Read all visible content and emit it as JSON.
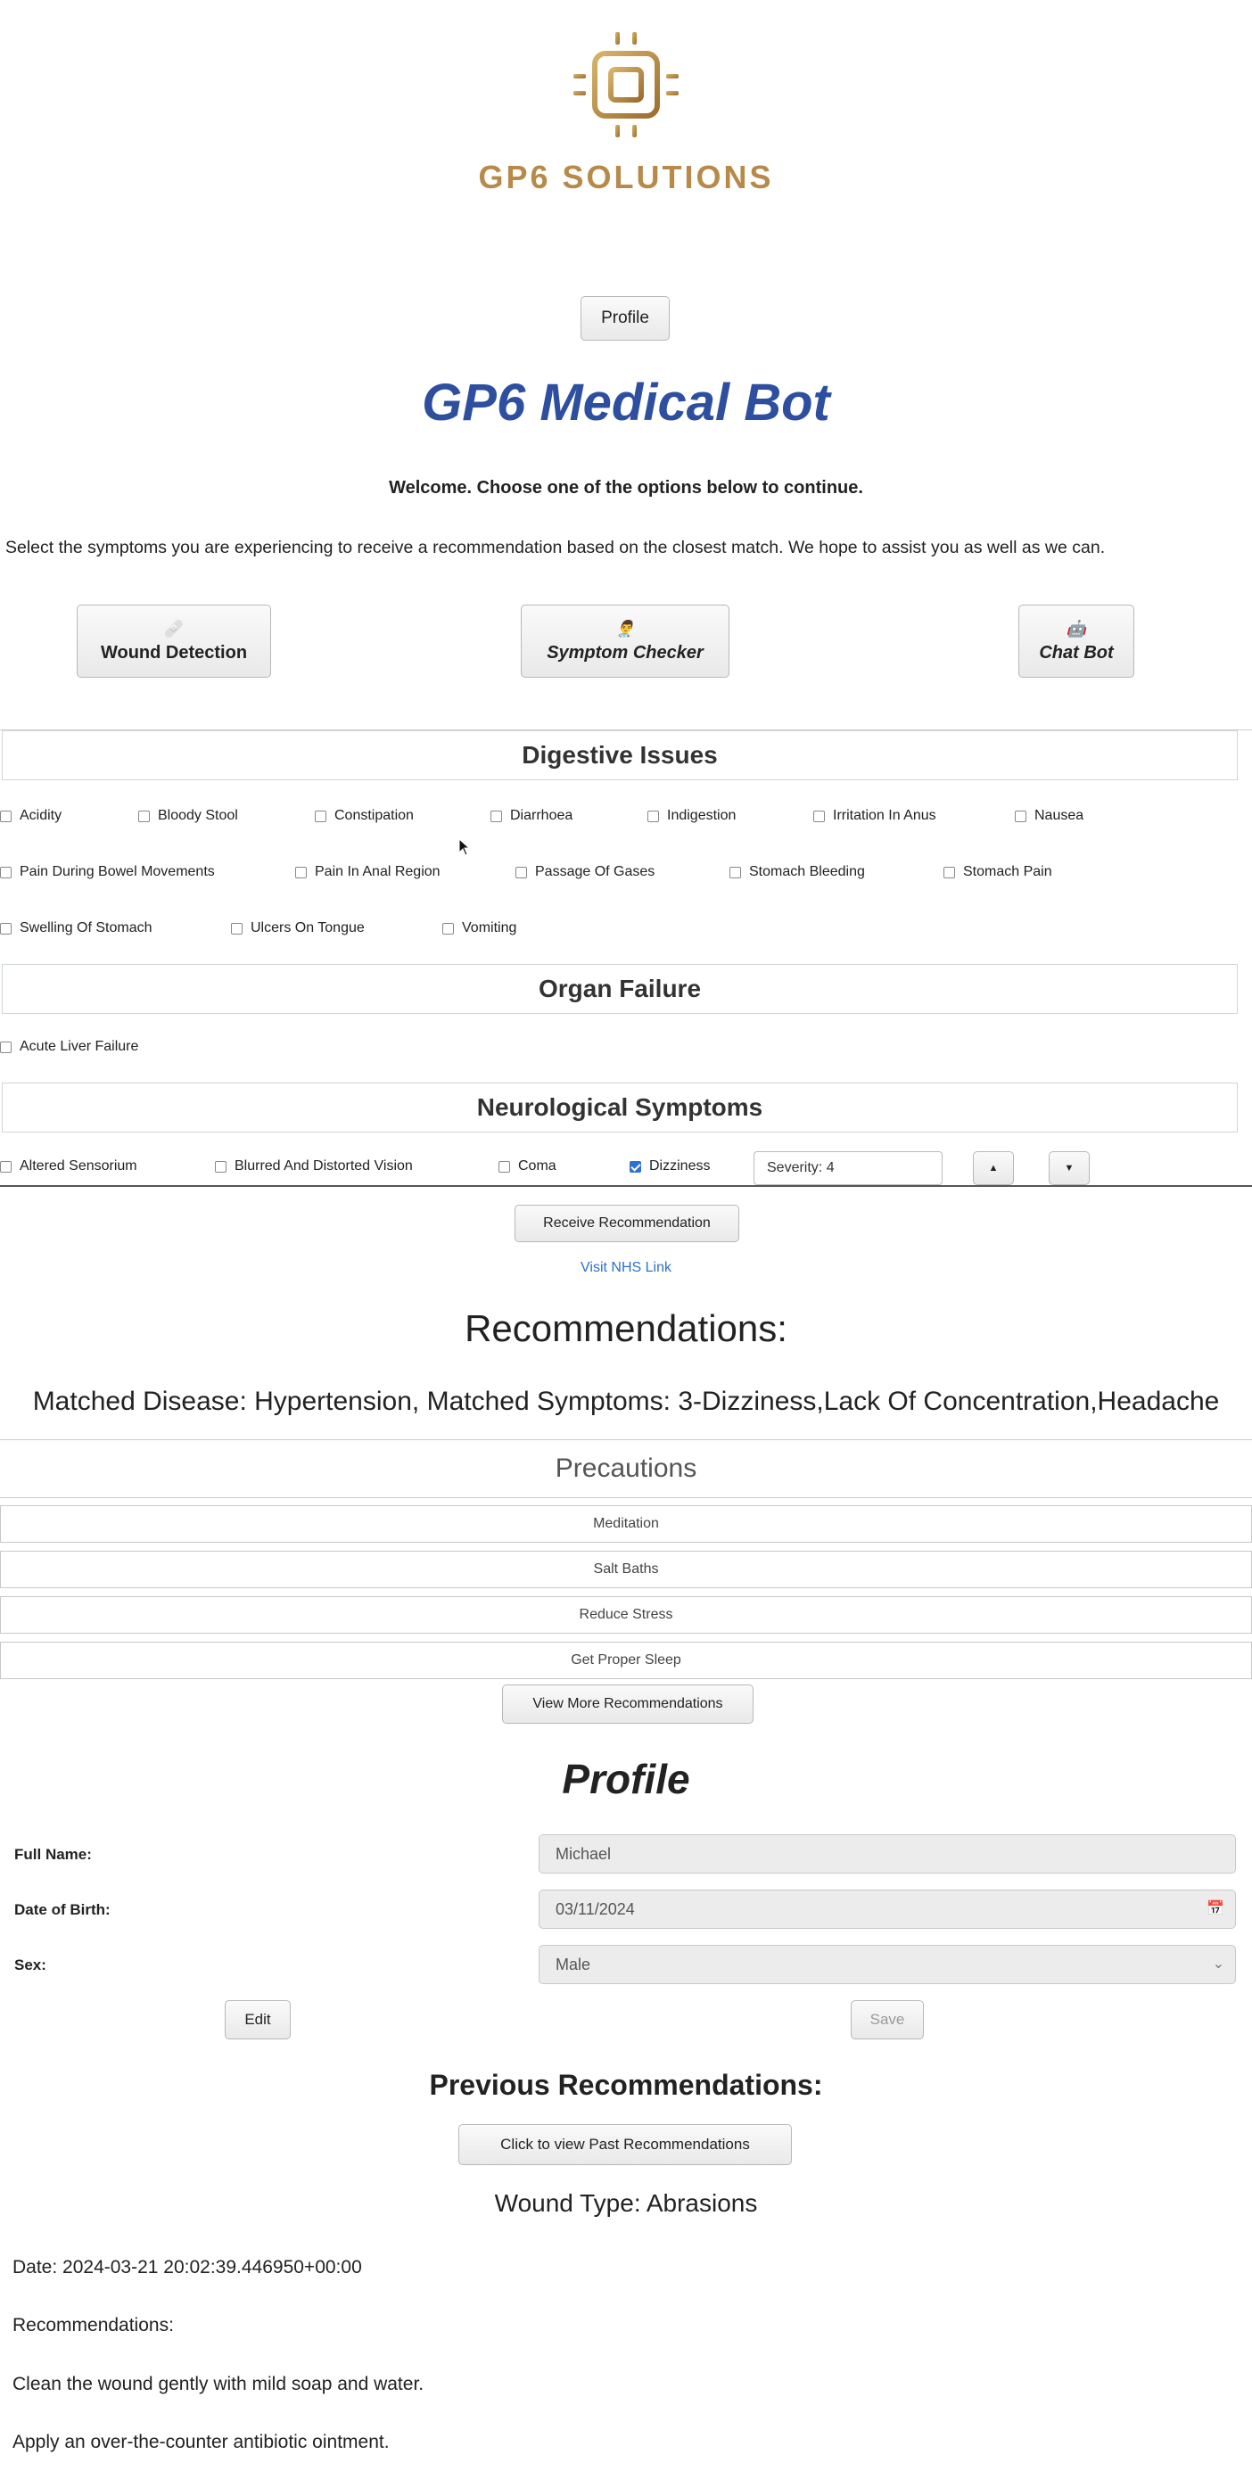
{
  "brand": {
    "name": "GP6 SOLUTIONS",
    "icon": "chip-icon",
    "color": "#b88a4a"
  },
  "header": {
    "profile_button": "Profile"
  },
  "page_title": "GP6 Medical Bot",
  "welcome": "Welcome. Choose one of the options below to continue.",
  "intro": "Select the symptoms you are experiencing to receive a recommendation based on the closest match. We hope to assist you as well as we can.",
  "modes": [
    {
      "label": "Wound Detection",
      "icon": "bandage-icon"
    },
    {
      "label": "Symptom Checker",
      "icon": "doctor-icon"
    },
    {
      "label": "Chat Bot",
      "icon": "robot-icon"
    }
  ],
  "sections": [
    {
      "title": "Digestive Issues",
      "rows": [
        [
          "Acidity",
          "Bloody Stool",
          "Constipation",
          "Diarrhoea",
          "Indigestion",
          "Irritation In Anus",
          "Nausea"
        ],
        [
          "Pain During Bowel Movements",
          "Pain In Anal Region",
          "Passage Of Gases",
          "Stomach Bleeding",
          "Stomach Pain"
        ],
        [
          "Swelling Of Stomach",
          "Ulcers On Tongue",
          "Vomiting"
        ]
      ]
    },
    {
      "title": "Organ Failure",
      "rows": [
        [
          "Acute Liver Failure"
        ]
      ]
    },
    {
      "title": "Neurological Symptoms",
      "rows": [
        [
          "Altered Sensorium",
          "Blurred And Distorted Vision",
          "Coma",
          "Dizziness"
        ]
      ],
      "checked": [
        "Dizziness"
      ],
      "severity_label": "Severity: 4",
      "severity_value": 4
    }
  ],
  "actions": {
    "receive_button": "Receive Recommendation",
    "nhs_link": "Visit NHS Link",
    "stepper_up": "▲",
    "stepper_down": "▼"
  },
  "recommendations": {
    "title": "Recommendations:",
    "matched": "Matched Disease: Hypertension, Matched Symptoms: 3-Dizziness,Lack Of Concentration,Headache",
    "precautions_title": "Precautions",
    "precautions": [
      "Meditation",
      "Salt Baths",
      "Reduce Stress",
      "Get Proper Sleep"
    ],
    "more_button": "View More Recommendations"
  },
  "profile": {
    "title": "Profile",
    "fields": [
      {
        "label": "Full Name:",
        "value": "Michael"
      },
      {
        "label": "Date of Birth:",
        "value": "03/11/2024"
      },
      {
        "label": "Sex:",
        "value": "Male"
      }
    ],
    "edit_button": "Edit",
    "save_button": "Save"
  },
  "previous": {
    "title": "Previous Recommendations:",
    "view_button": "Click to view Past Recommendations",
    "wound_type": "Wound Type: Abrasions",
    "date": "Date: 2024-03-21 20:02:39.446950+00:00",
    "rec_label": "Recommendations:",
    "items": [
      "Clean the wound gently with mild soap and water.",
      "Apply an over-the-counter antibiotic ointment."
    ]
  }
}
